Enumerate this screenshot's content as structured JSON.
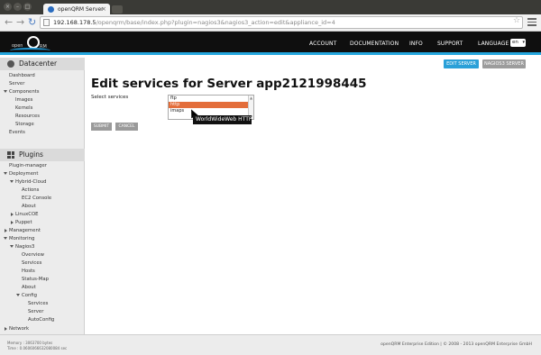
{
  "browser": {
    "tab_title": "openQRM Server",
    "url_host": "192.168.178.5",
    "url_path": "/openqrm/base/index.php?plugin=nagios3&nagios3_action=edit&appliance_id=4"
  },
  "header": {
    "logo_text_left": "open",
    "logo_text_right": "RM",
    "nav": [
      "ACCOUNT",
      "DOCUMENTATION",
      "INFO",
      "SUPPORT",
      "LANGUAGE"
    ],
    "language_value": "en"
  },
  "sidebar": {
    "datacenter_title": "Datacenter",
    "datacenter_items": [
      "Dashboard",
      "Server",
      "Components",
      "Images",
      "Kernels",
      "Resources",
      "Storage",
      "Events"
    ],
    "plugins_title": "Plugins",
    "plugin_items": [
      "Plugin-manager",
      "Deployment",
      "Hybrid-Cloud",
      "Actions",
      "EC2 Console",
      "About",
      "LinuxCOE",
      "Puppet",
      "Management",
      "Monitoring",
      "Nagios3",
      "Overview",
      "Services",
      "Hosts",
      "Status-Map",
      "About",
      "Config",
      "Services",
      "Server",
      "AutoConfig",
      "Network"
    ]
  },
  "main": {
    "btn_edit_server": "EDIT SERVER",
    "btn_nagios3_server": "NAGIOS3 SERVER",
    "title": "Edit services for Server app2121998445",
    "select_label": "Select services",
    "options": [
      "ftp",
      "http",
      "imaps"
    ],
    "selected_option": "http",
    "tooltip": "WorldWideWeb HTTP",
    "submit_label": "SUBMIT",
    "cancel_label": "CANCEL"
  },
  "footer": {
    "memory": "Memory : 3063700 bytes",
    "time": "Time : 0.0606066632080084 sec",
    "copyright": "openQRM Enterprise Edition | © 2008 - 2013 openQRM Enterprise GmbH"
  },
  "colors": {
    "accent_blue": "#24a6de",
    "selected_option": "#e36d3a"
  }
}
